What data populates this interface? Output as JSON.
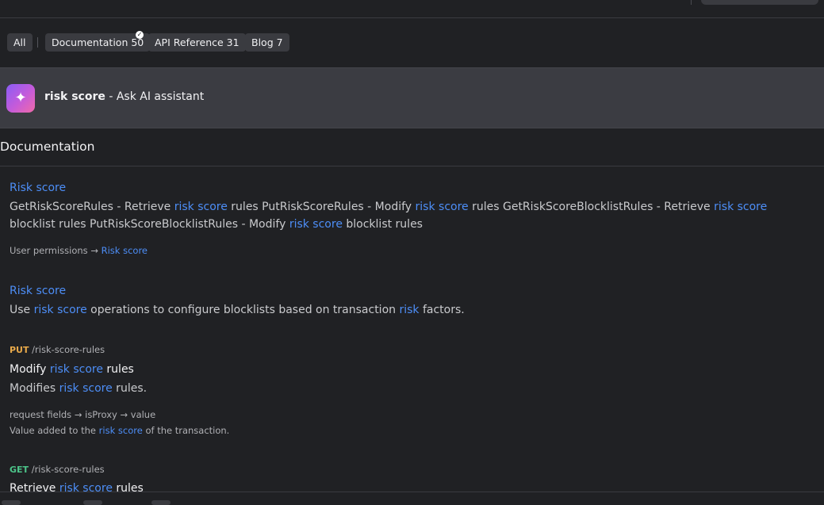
{
  "filters": {
    "all_label": "All",
    "documentation_label": "Documentation 50",
    "api_reference_label": "API Reference 31",
    "blog_label": "Blog 7"
  },
  "ai_assistant": {
    "query": "risk score",
    "suffix": " - Ask AI assistant"
  },
  "section": {
    "title": "Documentation"
  },
  "results": [
    {
      "title": "Risk score",
      "body_parts": [
        "GetRiskScoreRules - Retrieve ",
        "risk score",
        " rules PutRiskScoreRules - Modify ",
        "risk score",
        " rules GetRiskScoreBlocklistRules - Retrieve ",
        "risk score",
        " blocklist rules PutRiskScoreBlocklistRules - Modify ",
        "risk score",
        " blocklist rules"
      ],
      "breadcrumb_prefix": "User permissions → ",
      "breadcrumb_link": "Risk score"
    },
    {
      "title": "Risk score",
      "body_parts": [
        "Use ",
        "risk score",
        " operations to configure blocklists based on transaction ",
        "risk",
        " factors."
      ]
    }
  ],
  "endpoints": [
    {
      "method": "PUT",
      "path": "/risk-score-rules",
      "title_parts": [
        "Modify ",
        "risk score",
        " rules"
      ],
      "desc_parts": [
        "Modifies ",
        "risk score",
        " rules."
      ],
      "field_path": "request fields → isProxy → value",
      "field_desc_parts": [
        "Value added to the ",
        "risk score",
        " of the transaction."
      ]
    },
    {
      "method": "GET",
      "path": "/risk-score-rules",
      "title_parts": [
        "Retrieve ",
        "risk score",
        " rules"
      ]
    }
  ]
}
